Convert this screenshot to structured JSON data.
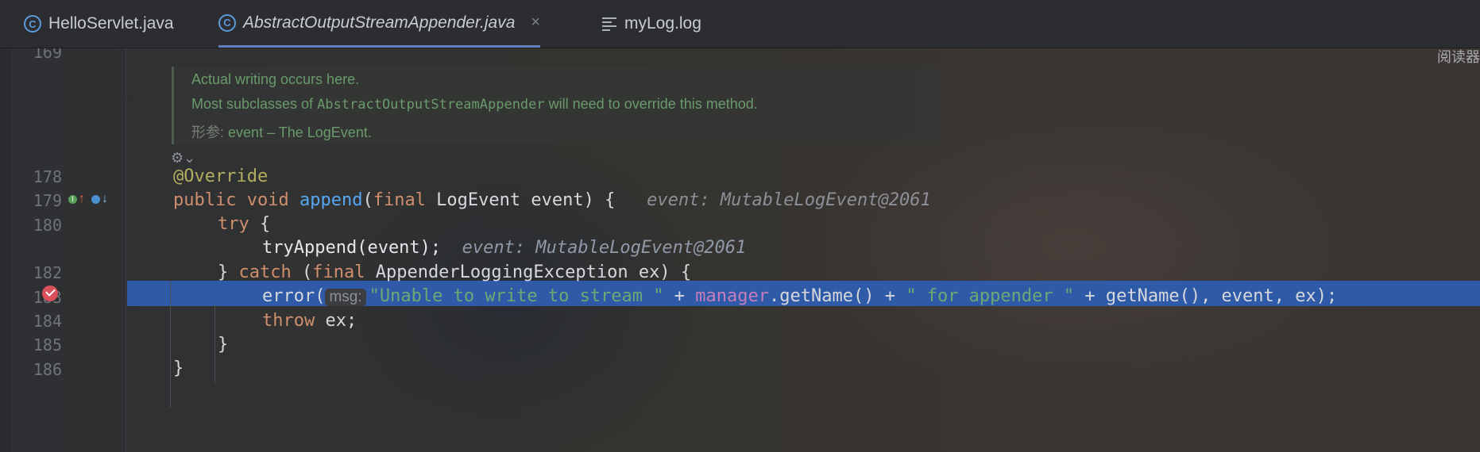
{
  "tabs": [
    {
      "label": "HelloServlet.java",
      "icon": "java-class-icon"
    },
    {
      "label": "AbstractOutputStreamAppender.java",
      "icon": "java-class-icon",
      "close": "×"
    },
    {
      "label": "myLog.log",
      "icon": "text-file-icon"
    }
  ],
  "reader_mode": "阅读器",
  "doc": {
    "line1": "Actual writing occurs here.",
    "line2_prefix": "Most subclasses of ",
    "line2_code": "AbstractOutputStreamAppender",
    "line2_suffix": " will need to override this method.",
    "param_tag": "形参:",
    "param_text": "event – The LogEvent."
  },
  "line_numbers": {
    "l169": "169",
    "l178": "178",
    "l179": "179",
    "l180": "180",
    "l182": "182",
    "l183": "183",
    "l184": "184",
    "l185": "185",
    "l186": "186"
  },
  "code": {
    "override": "@Override",
    "public": "public",
    "void": "void",
    "append": "append",
    "final1": "final",
    "sig_rest": " LogEvent event) {",
    "hint179": "event: MutableLogEvent@2061",
    "try": "try",
    "try_brace": " {",
    "tryAppend": "tryAppend(event);",
    "hint181": "event: MutableLogEvent@2061",
    "close_brace": "}",
    "catch": "catch",
    "final2": "final",
    "catch_rest": " AppenderLoggingException ex) {",
    "error": "error(",
    "msg_hint": "msg:",
    "str1": "\"Unable to write to stream \"",
    "plus1": " + ",
    "manager": "manager",
    "getname1": ".getName() + ",
    "str2": "\" for appender \"",
    "rest183": " + getName(), event, ex);",
    "throw": "throw",
    "throw_rest": " ex;"
  },
  "colors": {
    "accent": "#2f5aa8",
    "keyword": "#cf8e6d",
    "string": "#6aab73",
    "method": "#56a8f5",
    "annotation": "#b3ae60",
    "field": "#c77dbb",
    "breakpoint": "#d9505a"
  }
}
